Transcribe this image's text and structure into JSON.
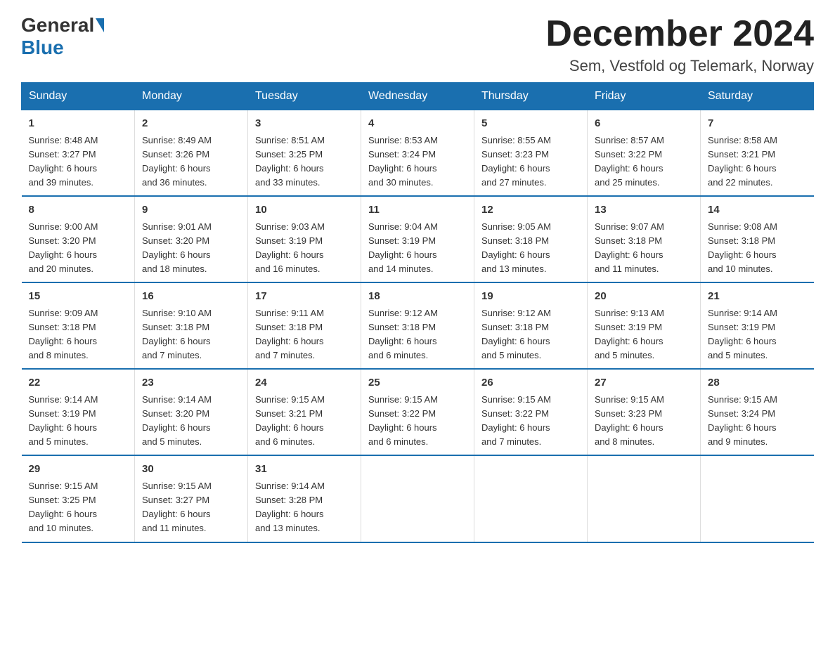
{
  "header": {
    "logo_general": "General",
    "logo_blue": "Blue",
    "title": "December 2024",
    "subtitle": "Sem, Vestfold og Telemark, Norway"
  },
  "calendar": {
    "days_of_week": [
      "Sunday",
      "Monday",
      "Tuesday",
      "Wednesday",
      "Thursday",
      "Friday",
      "Saturday"
    ],
    "weeks": [
      [
        {
          "day": "1",
          "info": "Sunrise: 8:48 AM\nSunset: 3:27 PM\nDaylight: 6 hours\nand 39 minutes."
        },
        {
          "day": "2",
          "info": "Sunrise: 8:49 AM\nSunset: 3:26 PM\nDaylight: 6 hours\nand 36 minutes."
        },
        {
          "day": "3",
          "info": "Sunrise: 8:51 AM\nSunset: 3:25 PM\nDaylight: 6 hours\nand 33 minutes."
        },
        {
          "day": "4",
          "info": "Sunrise: 8:53 AM\nSunset: 3:24 PM\nDaylight: 6 hours\nand 30 minutes."
        },
        {
          "day": "5",
          "info": "Sunrise: 8:55 AM\nSunset: 3:23 PM\nDaylight: 6 hours\nand 27 minutes."
        },
        {
          "day": "6",
          "info": "Sunrise: 8:57 AM\nSunset: 3:22 PM\nDaylight: 6 hours\nand 25 minutes."
        },
        {
          "day": "7",
          "info": "Sunrise: 8:58 AM\nSunset: 3:21 PM\nDaylight: 6 hours\nand 22 minutes."
        }
      ],
      [
        {
          "day": "8",
          "info": "Sunrise: 9:00 AM\nSunset: 3:20 PM\nDaylight: 6 hours\nand 20 minutes."
        },
        {
          "day": "9",
          "info": "Sunrise: 9:01 AM\nSunset: 3:20 PM\nDaylight: 6 hours\nand 18 minutes."
        },
        {
          "day": "10",
          "info": "Sunrise: 9:03 AM\nSunset: 3:19 PM\nDaylight: 6 hours\nand 16 minutes."
        },
        {
          "day": "11",
          "info": "Sunrise: 9:04 AM\nSunset: 3:19 PM\nDaylight: 6 hours\nand 14 minutes."
        },
        {
          "day": "12",
          "info": "Sunrise: 9:05 AM\nSunset: 3:18 PM\nDaylight: 6 hours\nand 13 minutes."
        },
        {
          "day": "13",
          "info": "Sunrise: 9:07 AM\nSunset: 3:18 PM\nDaylight: 6 hours\nand 11 minutes."
        },
        {
          "day": "14",
          "info": "Sunrise: 9:08 AM\nSunset: 3:18 PM\nDaylight: 6 hours\nand 10 minutes."
        }
      ],
      [
        {
          "day": "15",
          "info": "Sunrise: 9:09 AM\nSunset: 3:18 PM\nDaylight: 6 hours\nand 8 minutes."
        },
        {
          "day": "16",
          "info": "Sunrise: 9:10 AM\nSunset: 3:18 PM\nDaylight: 6 hours\nand 7 minutes."
        },
        {
          "day": "17",
          "info": "Sunrise: 9:11 AM\nSunset: 3:18 PM\nDaylight: 6 hours\nand 7 minutes."
        },
        {
          "day": "18",
          "info": "Sunrise: 9:12 AM\nSunset: 3:18 PM\nDaylight: 6 hours\nand 6 minutes."
        },
        {
          "day": "19",
          "info": "Sunrise: 9:12 AM\nSunset: 3:18 PM\nDaylight: 6 hours\nand 5 minutes."
        },
        {
          "day": "20",
          "info": "Sunrise: 9:13 AM\nSunset: 3:19 PM\nDaylight: 6 hours\nand 5 minutes."
        },
        {
          "day": "21",
          "info": "Sunrise: 9:14 AM\nSunset: 3:19 PM\nDaylight: 6 hours\nand 5 minutes."
        }
      ],
      [
        {
          "day": "22",
          "info": "Sunrise: 9:14 AM\nSunset: 3:19 PM\nDaylight: 6 hours\nand 5 minutes."
        },
        {
          "day": "23",
          "info": "Sunrise: 9:14 AM\nSunset: 3:20 PM\nDaylight: 6 hours\nand 5 minutes."
        },
        {
          "day": "24",
          "info": "Sunrise: 9:15 AM\nSunset: 3:21 PM\nDaylight: 6 hours\nand 6 minutes."
        },
        {
          "day": "25",
          "info": "Sunrise: 9:15 AM\nSunset: 3:22 PM\nDaylight: 6 hours\nand 6 minutes."
        },
        {
          "day": "26",
          "info": "Sunrise: 9:15 AM\nSunset: 3:22 PM\nDaylight: 6 hours\nand 7 minutes."
        },
        {
          "day": "27",
          "info": "Sunrise: 9:15 AM\nSunset: 3:23 PM\nDaylight: 6 hours\nand 8 minutes."
        },
        {
          "day": "28",
          "info": "Sunrise: 9:15 AM\nSunset: 3:24 PM\nDaylight: 6 hours\nand 9 minutes."
        }
      ],
      [
        {
          "day": "29",
          "info": "Sunrise: 9:15 AM\nSunset: 3:25 PM\nDaylight: 6 hours\nand 10 minutes."
        },
        {
          "day": "30",
          "info": "Sunrise: 9:15 AM\nSunset: 3:27 PM\nDaylight: 6 hours\nand 11 minutes."
        },
        {
          "day": "31",
          "info": "Sunrise: 9:14 AM\nSunset: 3:28 PM\nDaylight: 6 hours\nand 13 minutes."
        },
        {
          "day": "",
          "info": ""
        },
        {
          "day": "",
          "info": ""
        },
        {
          "day": "",
          "info": ""
        },
        {
          "day": "",
          "info": ""
        }
      ]
    ]
  }
}
